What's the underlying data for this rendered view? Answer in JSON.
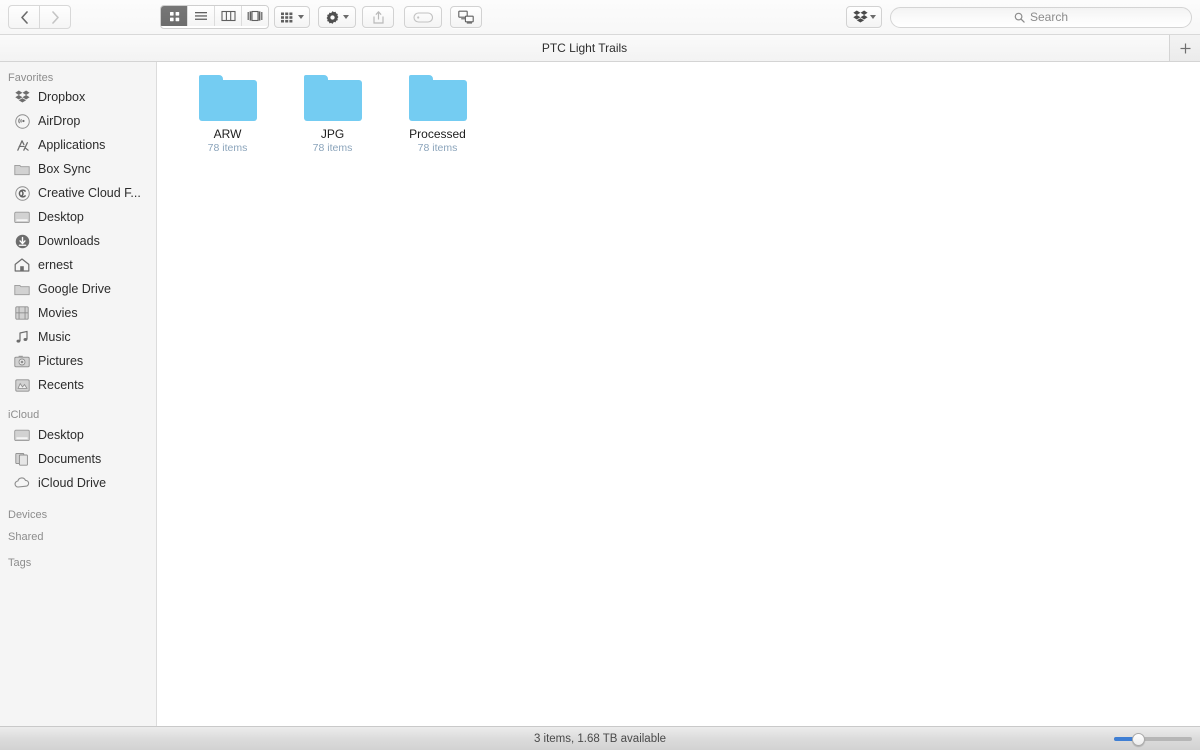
{
  "window": {
    "title": "PTC Light Trails"
  },
  "toolbar": {
    "back_icon": "chevron-left-icon",
    "forward_icon": "chevron-right-icon",
    "view_modes": [
      {
        "name": "icon-view",
        "icon": "grid-icon",
        "active": true
      },
      {
        "name": "list-view",
        "icon": "list-icon",
        "active": false
      },
      {
        "name": "column-view",
        "icon": "columns-icon",
        "active": false
      },
      {
        "name": "gallery-view",
        "icon": "gallery-icon",
        "active": false
      }
    ],
    "arrange_label": "arrange-icon",
    "action_label": "gear-icon",
    "share_label": "share-icon",
    "tag_label": "tag-icon",
    "airdrop_label": "connect-icon",
    "dropbox_label": "dropbox-icon"
  },
  "search": {
    "placeholder": "Search",
    "value": "",
    "icon": "search-icon"
  },
  "tabs": {
    "active_label": "PTC Light Trails",
    "add_label": "+"
  },
  "sidebar": {
    "sections": [
      {
        "header": "Favorites",
        "items": [
          {
            "label": "Dropbox",
            "icon": "dropbox-icon"
          },
          {
            "label": "AirDrop",
            "icon": "airdrop-icon"
          },
          {
            "label": "Applications",
            "icon": "applications-icon"
          },
          {
            "label": "Box Sync",
            "icon": "folder-icon"
          },
          {
            "label": "Creative Cloud F...",
            "icon": "creative-cloud-icon"
          },
          {
            "label": "Desktop",
            "icon": "desktop-icon"
          },
          {
            "label": "Downloads",
            "icon": "downloads-icon"
          },
          {
            "label": "ernest",
            "icon": "home-icon"
          },
          {
            "label": "Google Drive",
            "icon": "folder-icon"
          },
          {
            "label": "Movies",
            "icon": "movies-icon"
          },
          {
            "label": "Music",
            "icon": "music-icon"
          },
          {
            "label": "Pictures",
            "icon": "pictures-icon"
          },
          {
            "label": "Recents",
            "icon": "recents-icon"
          }
        ]
      },
      {
        "header": "iCloud",
        "items": [
          {
            "label": "Desktop",
            "icon": "desktop-icon"
          },
          {
            "label": "Documents",
            "icon": "documents-icon"
          },
          {
            "label": "iCloud Drive",
            "icon": "cloud-icon"
          }
        ]
      },
      {
        "header": "Devices",
        "items": []
      },
      {
        "header": "Shared",
        "items": []
      },
      {
        "header": "Tags",
        "items": []
      }
    ]
  },
  "content": {
    "files": [
      {
        "name": "ARW",
        "subtitle": "78 items",
        "kind": "folder"
      },
      {
        "name": "JPG",
        "subtitle": "78 items",
        "kind": "folder"
      },
      {
        "name": "Processed",
        "subtitle": "78 items",
        "kind": "folder"
      }
    ]
  },
  "status": {
    "text": "3 items, 1.68 TB available",
    "zoom_value": 25
  },
  "colors": {
    "folder_blue": "#74ccf2",
    "subtitle_blue": "#8ba4bb",
    "slider_accent": "#3f7fd4",
    "selected_view_bg": "#6d6d6d"
  }
}
